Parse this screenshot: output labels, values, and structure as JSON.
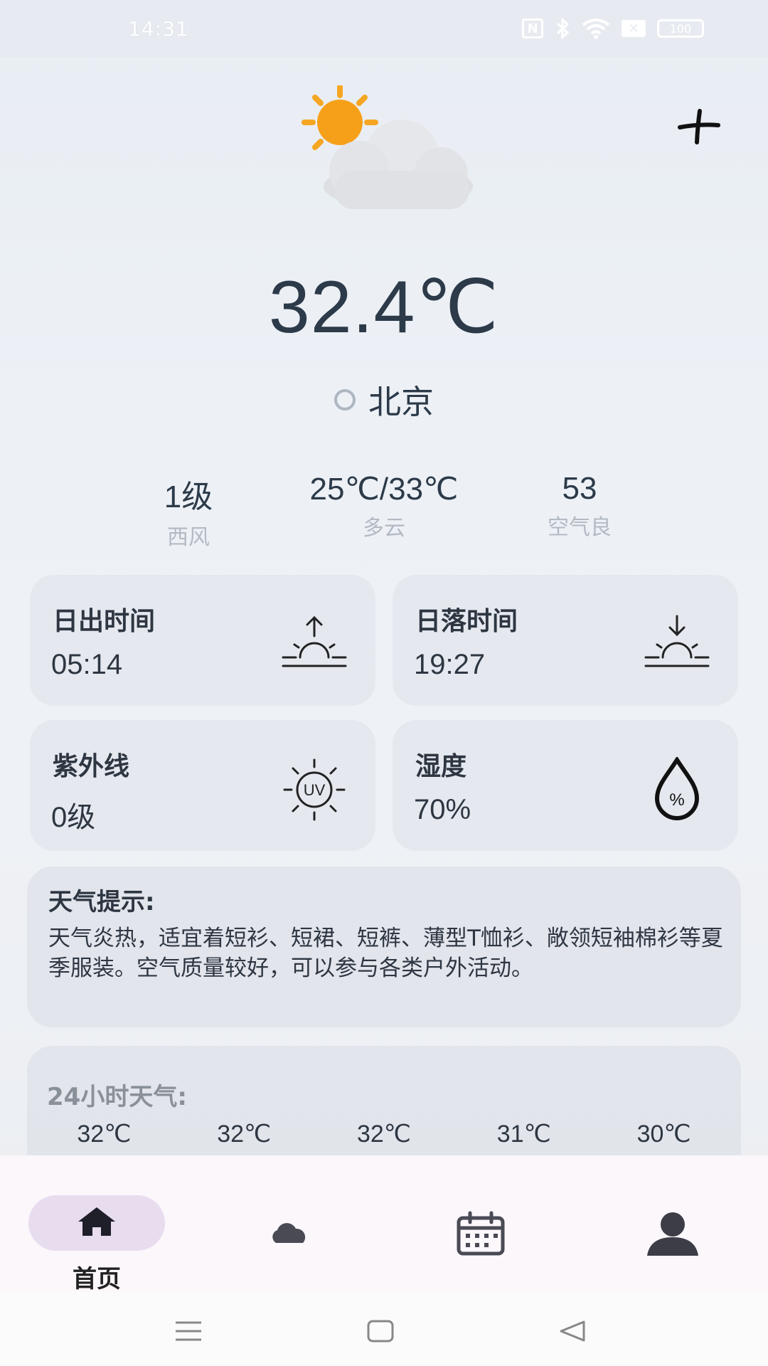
{
  "status_bar": {
    "time": "14:31",
    "nfc": "N",
    "battery": "100"
  },
  "hero": {
    "temperature": "32.4℃",
    "city": "北京"
  },
  "summary": {
    "wind_level": "1级",
    "wind_dir": "西风",
    "temp_range": "25℃/33℃",
    "condition": "多云",
    "aqi": "53",
    "aqi_label": "空气良"
  },
  "cards": {
    "sunrise": {
      "title": "日出时间",
      "value": "05:14",
      "icon": "sunrise-icon"
    },
    "sunset": {
      "title": "日落时间",
      "value": "19:27",
      "icon": "sunset-icon"
    },
    "uv": {
      "title": "紫外线",
      "value": "0级",
      "icon": "uv-icon",
      "icon_text": "UV"
    },
    "humidity": {
      "title": "湿度",
      "value": "70%",
      "icon": "humidity-icon",
      "icon_text": "%"
    }
  },
  "tips": {
    "title": "天气提示:",
    "text": "天气炎热，适宜着短衫、短裙、短裤、薄型T恤衫、敞领短袖棉衫等夏季服装。空气质量较好，可以参与各类户外活动。"
  },
  "hourly": {
    "title": "24小时天气:",
    "temps": [
      "32℃",
      "32℃",
      "32℃",
      "31℃",
      "30℃"
    ]
  },
  "bottom_nav": {
    "home_label": "首页",
    "items": [
      "home-icon",
      "cloud-icon",
      "calendar-icon",
      "profile-icon"
    ]
  },
  "colors": {
    "accent_pill": "#e8dcef",
    "text_primary": "#2c3a49",
    "text_muted": "#b3bac4",
    "sun": "#f5a623"
  }
}
